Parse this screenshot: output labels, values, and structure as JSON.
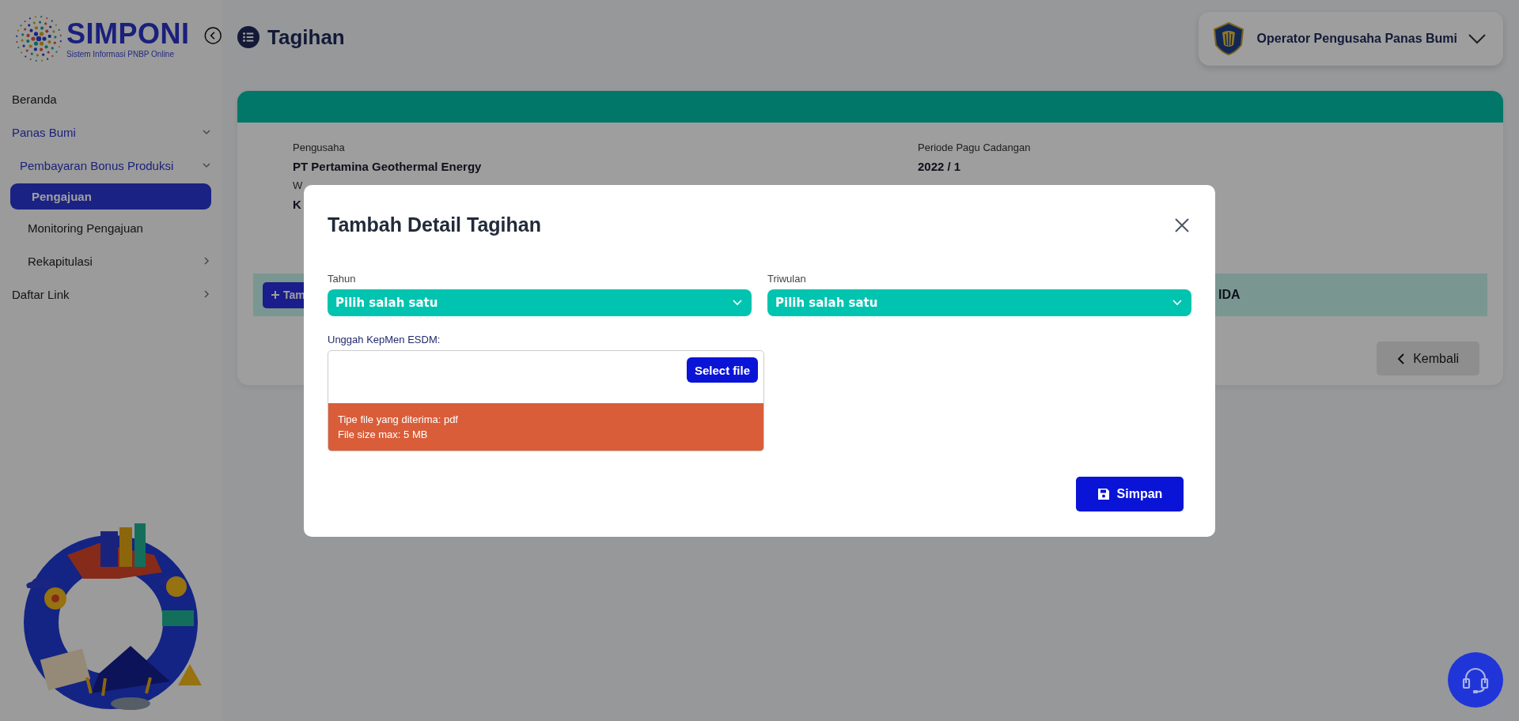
{
  "sidebar": {
    "logo": {
      "title": "SIMPONI",
      "subtitle": "Sistem Informasi PNBP Online"
    },
    "items": [
      {
        "label": "Beranda",
        "selected": false
      },
      {
        "label": "Panas Bumi",
        "selected": false,
        "expanded": true,
        "children": [
          {
            "label": "Pembayaran Bonus Produksi",
            "selected": false,
            "expanded": true,
            "children": [
              {
                "label": "Pengajuan",
                "selected": true
              },
              {
                "label": "Monitoring Pengajuan",
                "selected": false
              },
              {
                "label": "Rekapitulasi",
                "selected": false,
                "expanded": false
              }
            ]
          }
        ]
      },
      {
        "label": "Daftar Link",
        "selected": false,
        "expanded": false
      }
    ]
  },
  "header": {
    "title": "Tagihan",
    "user": {
      "name": "Operator Pengusaha Panas Bumi"
    }
  },
  "card": {
    "fields": [
      {
        "label": "Pengusaha",
        "value": "PT Pertamina Geothermal Energy"
      },
      {
        "label": "Periode Pagu Cadangan",
        "value": "2022 / 1"
      },
      {
        "label": "W",
        "value": "K"
      }
    ],
    "add_button": "Tam",
    "info_text": "IDA",
    "back_button": "Kembali"
  },
  "modal": {
    "title": "Tambah Detail Tagihan",
    "selects": [
      {
        "label": "Tahun",
        "value": "Pilih salah satu"
      },
      {
        "label": "Triwulan",
        "value": "Pilih salah satu"
      }
    ],
    "upload": {
      "label": "Unggah KepMen ESDM:",
      "button": "Select file",
      "hints": [
        "Tipe file yang diterima: pdf",
        "File size max: 5 MB"
      ]
    },
    "save_button": "Simpan"
  }
}
